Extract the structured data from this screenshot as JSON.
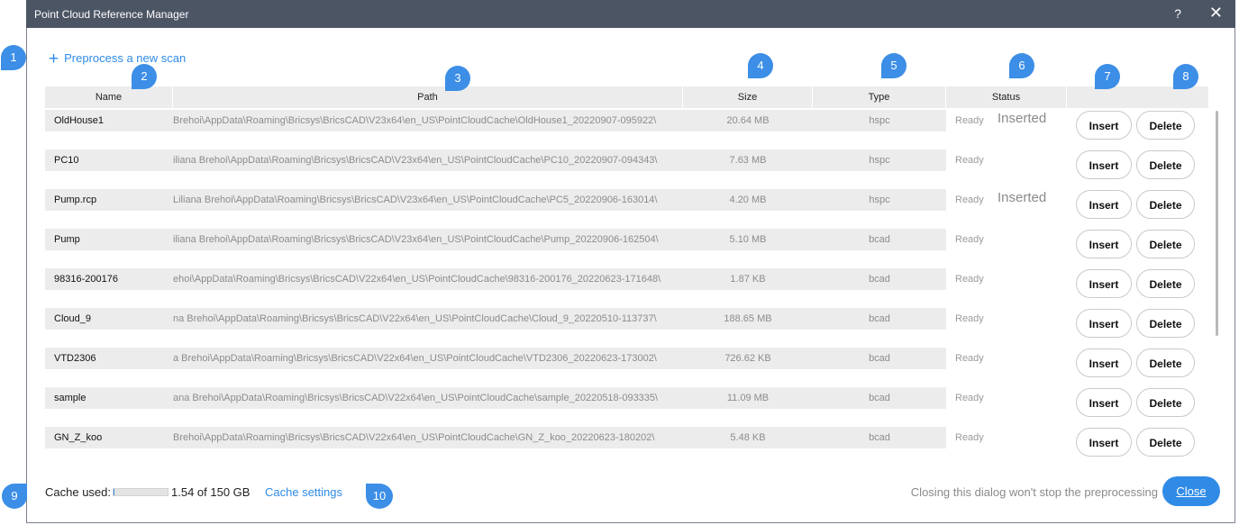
{
  "window": {
    "title": "Point Cloud Reference Manager",
    "help_label": "?",
    "close_label": "✕"
  },
  "toolbar": {
    "plus_label": "+",
    "preprocess_label": "Preprocess a new scan"
  },
  "columns": {
    "name": "Name",
    "path": "Path",
    "size": "Size",
    "type": "Type",
    "status": "Status"
  },
  "rows": [
    {
      "name": "OldHouse1",
      "path": "Brehoi\\AppData\\Roaming\\Bricsys\\BricsCAD\\V23x64\\en_US\\PointCloudCache\\OldHouse1_20220907-095922\\",
      "size": "20.64 MB",
      "type": "hspc",
      "ready": "Ready",
      "status": "Inserted",
      "insert": "Insert",
      "delete": "Delete"
    },
    {
      "name": "PC10",
      "path": "iliana Brehoi\\AppData\\Roaming\\Bricsys\\BricsCAD\\V23x64\\en_US\\PointCloudCache\\PC10_20220907-094343\\",
      "size": "7.63 MB",
      "type": "hspc",
      "ready": "Ready",
      "status": "",
      "insert": "Insert",
      "delete": "Delete"
    },
    {
      "name": "Pump.rcp",
      "path": "Liliana Brehoi\\AppData\\Roaming\\Bricsys\\BricsCAD\\V23x64\\en_US\\PointCloudCache\\PC5_20220906-163014\\",
      "size": "4.20 MB",
      "type": "hspc",
      "ready": "Ready",
      "status": "Inserted",
      "insert": "Insert",
      "delete": "Delete"
    },
    {
      "name": "Pump",
      "path": "iliana Brehoi\\AppData\\Roaming\\Bricsys\\BricsCAD\\V23x64\\en_US\\PointCloudCache\\Pump_20220906-162504\\",
      "size": "5.10 MB",
      "type": "bcad",
      "ready": "Ready",
      "status": "",
      "insert": "Insert",
      "delete": "Delete"
    },
    {
      "name": "98316-200176",
      "path": "ehoi\\AppData\\Roaming\\Bricsys\\BricsCAD\\V22x64\\en_US\\PointCloudCache\\98316-200176_20220623-171648\\",
      "size": "1.87 KB",
      "type": "bcad",
      "ready": "Ready",
      "status": "",
      "insert": "Insert",
      "delete": "Delete"
    },
    {
      "name": "Cloud_9",
      "path": "na Brehoi\\AppData\\Roaming\\Bricsys\\BricsCAD\\V22x64\\en_US\\PointCloudCache\\Cloud_9_20220510-113737\\",
      "size": "188.65 MB",
      "type": "bcad",
      "ready": "Ready",
      "status": "",
      "insert": "Insert",
      "delete": "Delete"
    },
    {
      "name": "VTD2306",
      "path": "a Brehoi\\AppData\\Roaming\\Bricsys\\BricsCAD\\V22x64\\en_US\\PointCloudCache\\VTD2306_20220623-173002\\",
      "size": "726.62 KB",
      "type": "bcad",
      "ready": "Ready",
      "status": "",
      "insert": "Insert",
      "delete": "Delete"
    },
    {
      "name": "sample",
      "path": "ana Brehoi\\AppData\\Roaming\\Bricsys\\BricsCAD\\V22x64\\en_US\\PointCloudCache\\sample_20220518-093335\\",
      "size": "11.09 MB",
      "type": "bcad",
      "ready": "Ready",
      "status": "",
      "insert": "Insert",
      "delete": "Delete"
    },
    {
      "name": "GN_Z_koo",
      "path": "Brehoi\\AppData\\Roaming\\Bricsys\\BricsCAD\\V22x64\\en_US\\PointCloudCache\\GN_Z_koo_20220623-180202\\",
      "size": "5.48 KB",
      "type": "bcad",
      "ready": "Ready",
      "status": "",
      "insert": "Insert",
      "delete": "Delete"
    }
  ],
  "footer": {
    "cache_label": "Cache used:",
    "cache_amount": "1.54 of 150 GB",
    "cache_fraction": 0.0103,
    "cache_settings": "Cache settings",
    "note": "Closing this dialog won't stop the preprocessing",
    "close_label": "Close"
  },
  "callouts": [
    "1",
    "2",
    "3",
    "4",
    "5",
    "6",
    "7",
    "8",
    "9",
    "10"
  ],
  "colors": {
    "accent": "#2f8be6",
    "titlebar": "#4c5564",
    "callout": "#3c8ee6"
  }
}
